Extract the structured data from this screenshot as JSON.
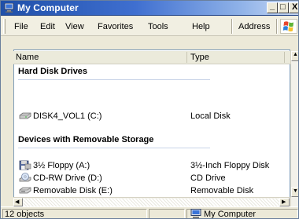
{
  "window": {
    "title": "My Computer",
    "minimize_glyph": "_",
    "maximize_glyph": "□",
    "close_glyph": "X"
  },
  "menu": {
    "items": [
      "File",
      "Edit",
      "View",
      "Favorites",
      "Tools",
      "Help"
    ],
    "address_label": "Address"
  },
  "list": {
    "columns": [
      "Name",
      "Type"
    ],
    "groups": [
      {
        "title": "Hard Disk Drives",
        "items": [
          {
            "name": "DISK4_VOL1 (C:)",
            "type": "Local Disk",
            "icon": "hard-disk-icon"
          }
        ]
      },
      {
        "title": "Devices with Removable Storage",
        "items": [
          {
            "name": "3½ Floppy (A:)",
            "type": "3½-Inch Floppy Disk",
            "icon": "floppy-drive-icon"
          },
          {
            "name": "CD-RW Drive (D:)",
            "type": "CD Drive",
            "icon": "cd-drive-icon"
          },
          {
            "name": "Removable Disk (E:)",
            "type": "Removable Disk",
            "icon": "removable-disk-icon"
          }
        ]
      }
    ]
  },
  "status": {
    "objects": "12 objects",
    "location": "My Computer"
  },
  "scrollbar": {
    "up_glyph": "▲",
    "down_glyph": "▼",
    "left_glyph": "◀",
    "right_glyph": "▶"
  }
}
